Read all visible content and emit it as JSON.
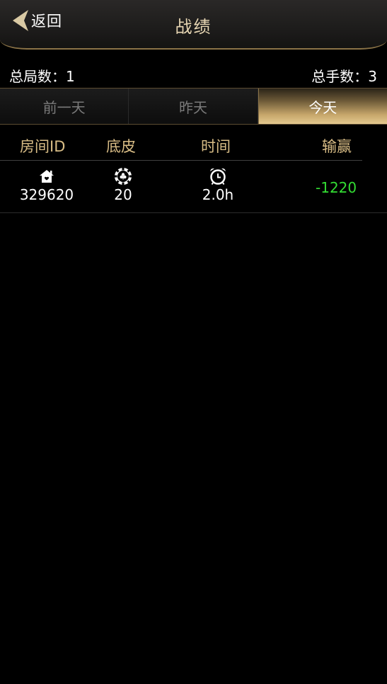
{
  "header": {
    "back_label": "返回",
    "title": "战绩"
  },
  "summary": {
    "total_games_label": "总局数：1",
    "total_hands_label": "总手数：3"
  },
  "tabs": [
    {
      "label": "前一天",
      "active": false
    },
    {
      "label": "昨天",
      "active": false
    },
    {
      "label": "今天",
      "active": true
    }
  ],
  "table": {
    "columns": [
      "房间ID",
      "底皮",
      "时间",
      "输赢"
    ],
    "rows": [
      {
        "room_id": "329620",
        "base": "20",
        "time": "2.0h",
        "result": "-1220",
        "room_icon": "house-icon",
        "base_icon": "poker-chip-icon",
        "time_icon": "alarm-clock-icon"
      }
    ]
  },
  "colors": {
    "accent_gold": "#d9bd86",
    "win_loss_green": "#33dd33",
    "background": "#000000"
  }
}
